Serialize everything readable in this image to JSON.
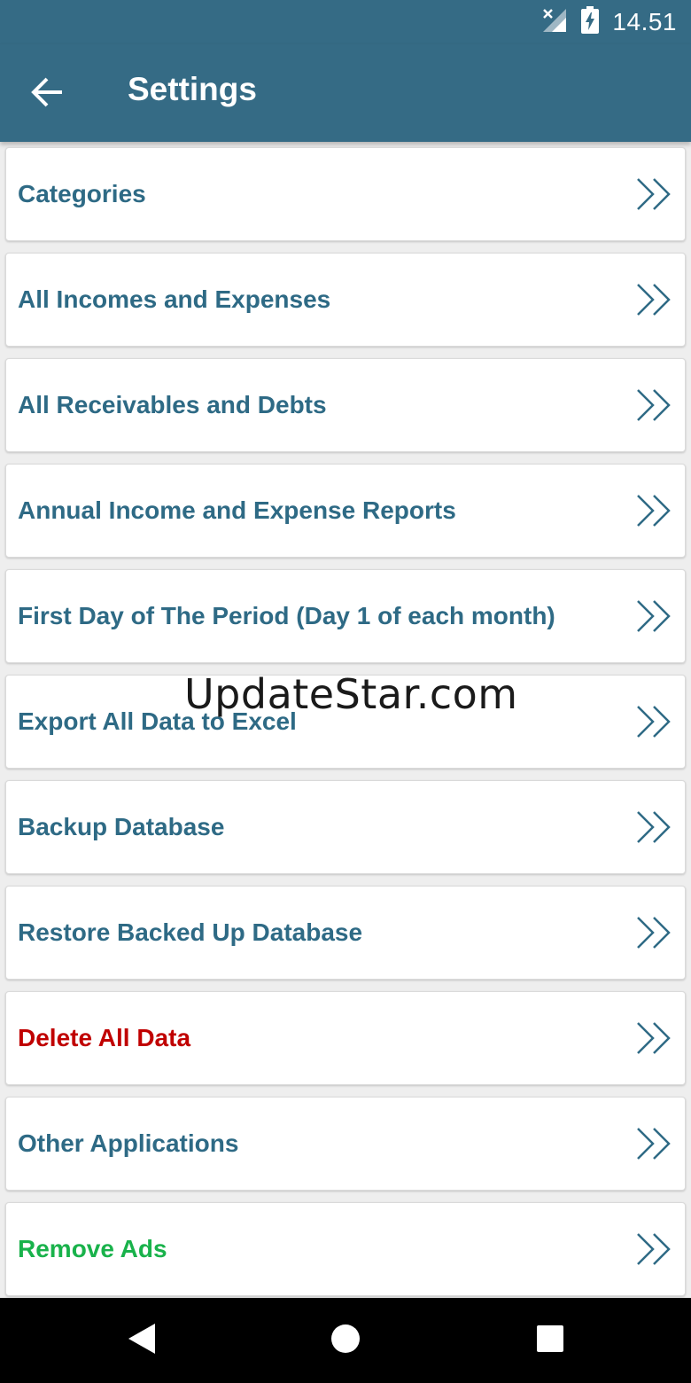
{
  "status_bar": {
    "time": "14.51"
  },
  "app_bar": {
    "title": "Settings"
  },
  "settings_items": [
    {
      "label": "Categories",
      "color": "#2e6a85"
    },
    {
      "label": "All Incomes and Expenses",
      "color": "#2e6a85"
    },
    {
      "label": "All Receivables and Debts",
      "color": "#2e6a85"
    },
    {
      "label": "Annual Income and Expense Reports",
      "color": "#2e6a85"
    },
    {
      "label": "First Day of The Period (Day 1 of each month)",
      "color": "#2e6a85"
    },
    {
      "label": "Export All Data to Excel",
      "color": "#2e6a85"
    },
    {
      "label": "Backup Database",
      "color": "#2e6a85"
    },
    {
      "label": "Restore Backed Up Database",
      "color": "#2e6a85"
    },
    {
      "label": "Delete All Data",
      "color": "#c00000"
    },
    {
      "label": "Other Applications",
      "color": "#2e6a85"
    },
    {
      "label": "Remove Ads",
      "color": "#19b24b"
    }
  ],
  "watermark": "UpdateStar.com",
  "icons": {
    "status": [
      "no-signal-icon",
      "battery-charging-icon"
    ],
    "app_bar": "back-arrow-icon",
    "item": "double-chevron-right-icon",
    "nav": [
      "back-triangle-icon",
      "home-circle-icon",
      "recents-square-icon"
    ]
  },
  "colors": {
    "primary": "#356b85",
    "item_text": "#2e6a85",
    "danger": "#c00000",
    "success": "#19b24b"
  }
}
